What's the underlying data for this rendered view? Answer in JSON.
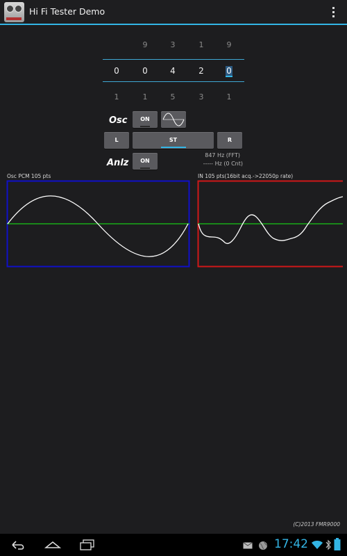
{
  "app": {
    "title": "Hi Fi Tester Demo"
  },
  "picker": {
    "above": [
      "9",
      "3",
      "1",
      "9"
    ],
    "current": [
      "0",
      "0",
      "4",
      "2",
      "0"
    ],
    "below": [
      "1",
      "1",
      "5",
      "3",
      "1"
    ]
  },
  "controls": {
    "osc_label": "Osc",
    "osc_on": "ON",
    "left": "L",
    "stereo": "ST",
    "right": "R",
    "anlz_label": "Anlz",
    "anlz_on": "ON",
    "fft_readout": "847 Hz (FFT)",
    "cnt_readout": "----- Hz (0 Cnt)"
  },
  "plots": {
    "left_title": "Osc PCM 105 pts",
    "right_title": "IN 105 pts(16bit acq.->22050p rate)",
    "left_border_color": "#1010c8",
    "right_border_color": "#d01818",
    "center_line_color": "#18c818"
  },
  "footer": {
    "copyright": "(C)2013 FMR9000"
  },
  "statusbar": {
    "time": "17:42",
    "icons": [
      "back-icon",
      "home-icon",
      "recents-icon",
      "gmail-icon",
      "globe-icon",
      "wifi-icon",
      "bluetooth-icon",
      "battery-icon"
    ]
  }
}
